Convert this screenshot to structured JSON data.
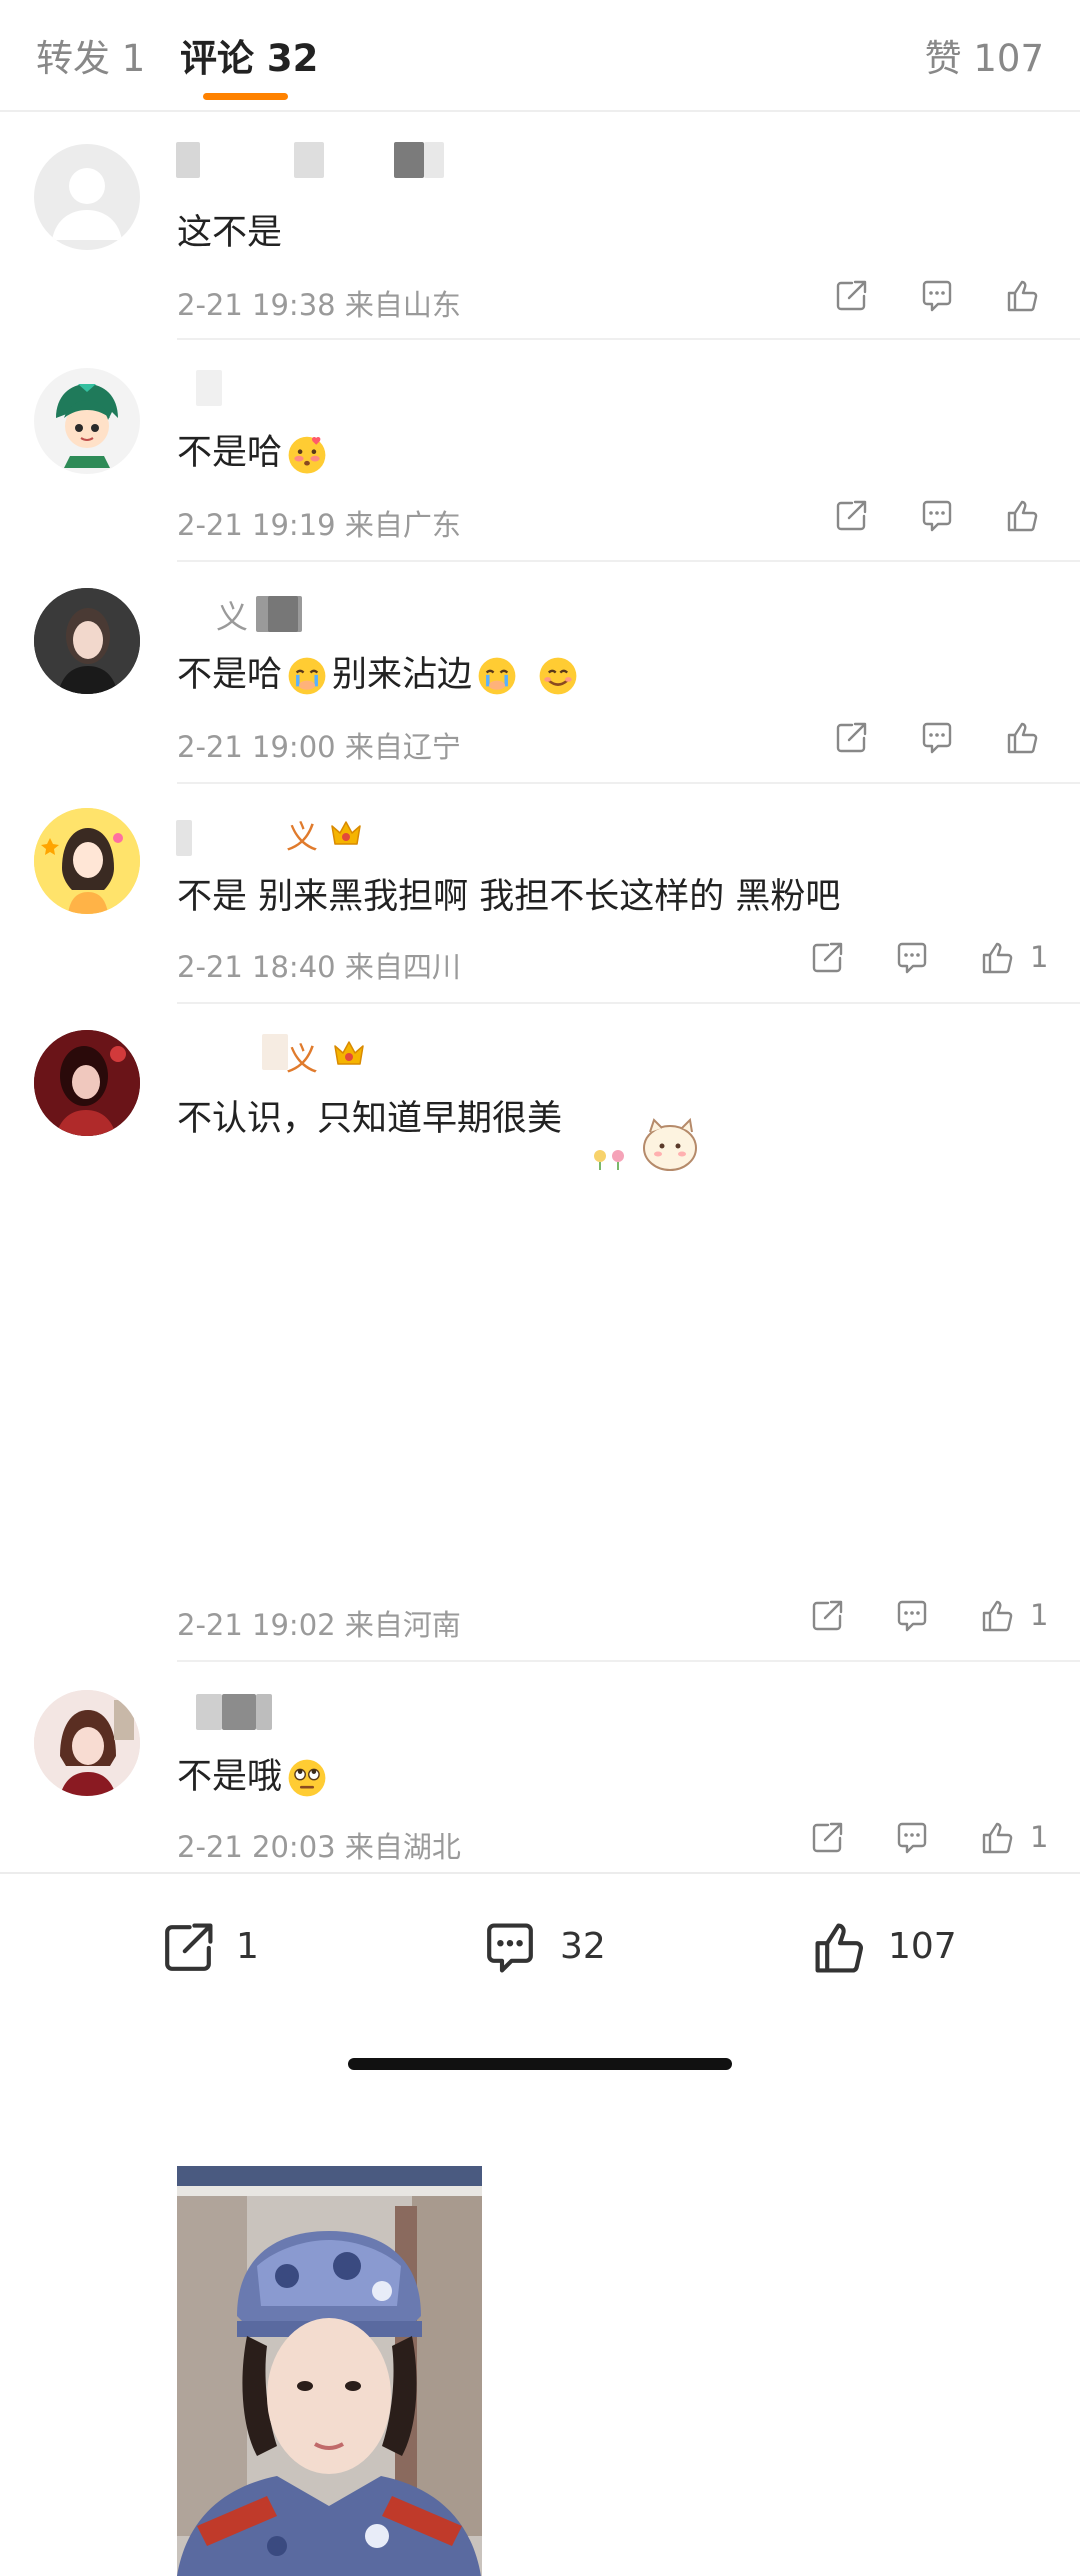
{
  "tabs": {
    "repost": "转发 1",
    "comment": "评论 32",
    "like": "赞 107",
    "accent": "#ff8200"
  },
  "comments": [
    {
      "name_visible": "",
      "text": "这不是",
      "time": "2-21 19:38",
      "location": "来自山东",
      "likes": ""
    },
    {
      "name_visible": "",
      "text": "不是哈",
      "emoji": "blushing-hands-emoji",
      "time": "2-21 19:19",
      "location": "来自广东",
      "likes": ""
    },
    {
      "name_visible": "义",
      "text_1": "不是哈",
      "text_2": "别来沾边",
      "emoji": "crying-emoji",
      "time": "2-21 19:00",
      "location": "来自辽宁",
      "likes": ""
    },
    {
      "name_visible": "义",
      "text": "不是 别来黑我担啊 我担不长这样的 黑粉吧",
      "time": "2-21 18:40",
      "location": "来自四川",
      "likes": "1"
    },
    {
      "name_visible": "义",
      "text": "不认识，只知道早期很美",
      "time": "2-21 19:02",
      "location": "来自河南",
      "likes": "1"
    },
    {
      "name_visible": "",
      "text": "不是哦",
      "emoji": "eye-roll-emoji",
      "time": "2-21 20:03",
      "location": "来自湖北",
      "likes": "1"
    }
  ],
  "bottombar": {
    "share_count": "1",
    "comment_count": "32",
    "like_count": "107"
  }
}
